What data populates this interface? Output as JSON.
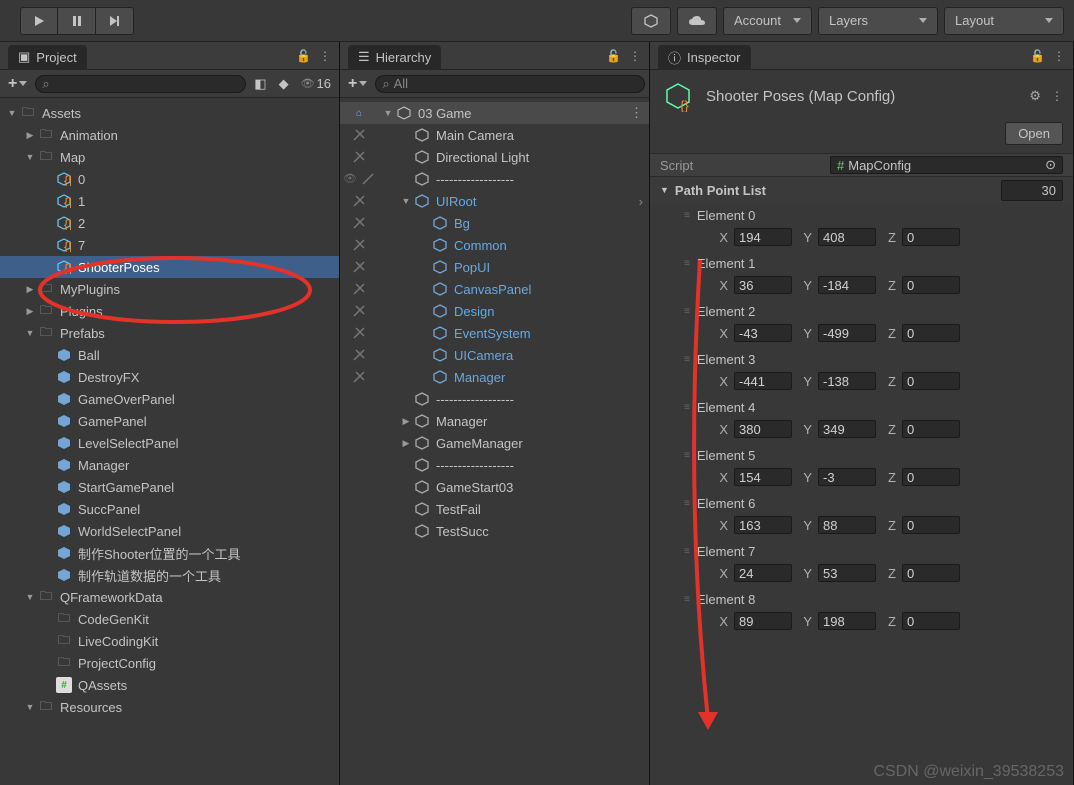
{
  "toolbar": {
    "account": "Account",
    "layers": "Layers",
    "layout": "Layout"
  },
  "project": {
    "title": "Project",
    "hidden_count": "16",
    "search_placeholder": "",
    "tree": [
      {
        "label": "Assets",
        "type": "folder",
        "depth": 0,
        "arrow": "open"
      },
      {
        "label": "Animation",
        "type": "folder",
        "depth": 1,
        "arrow": "closed"
      },
      {
        "label": "Map",
        "type": "folder",
        "depth": 1,
        "arrow": "open"
      },
      {
        "label": "0",
        "type": "asset-variant",
        "depth": 2,
        "arrow": "none"
      },
      {
        "label": "1",
        "type": "asset-variant",
        "depth": 2,
        "arrow": "none"
      },
      {
        "label": "2",
        "type": "asset-variant",
        "depth": 2,
        "arrow": "none"
      },
      {
        "label": "7",
        "type": "asset-variant",
        "depth": 2,
        "arrow": "none"
      },
      {
        "label": "ShooterPoses",
        "type": "asset-variant",
        "depth": 2,
        "arrow": "none",
        "selected": true
      },
      {
        "label": "MyPlugins",
        "type": "folder",
        "depth": 1,
        "arrow": "closed"
      },
      {
        "label": "Plugins",
        "type": "folder",
        "depth": 1,
        "arrow": "closed"
      },
      {
        "label": "Prefabs",
        "type": "folder",
        "depth": 1,
        "arrow": "open"
      },
      {
        "label": "Ball",
        "type": "prefab",
        "depth": 2,
        "arrow": "none"
      },
      {
        "label": "DestroyFX",
        "type": "prefab",
        "depth": 2,
        "arrow": "none"
      },
      {
        "label": "GameOverPanel",
        "type": "prefab",
        "depth": 2,
        "arrow": "none"
      },
      {
        "label": "GamePanel",
        "type": "prefab",
        "depth": 2,
        "arrow": "none"
      },
      {
        "label": "LevelSelectPanel",
        "type": "prefab",
        "depth": 2,
        "arrow": "none"
      },
      {
        "label": "Manager",
        "type": "prefab",
        "depth": 2,
        "arrow": "none"
      },
      {
        "label": "StartGamePanel",
        "type": "prefab",
        "depth": 2,
        "arrow": "none"
      },
      {
        "label": "SuccPanel",
        "type": "prefab",
        "depth": 2,
        "arrow": "none"
      },
      {
        "label": "WorldSelectPanel",
        "type": "prefab",
        "depth": 2,
        "arrow": "none"
      },
      {
        "label": "制作Shooter位置的一个工具",
        "type": "prefab",
        "depth": 2,
        "arrow": "none"
      },
      {
        "label": "制作轨道数据的一个工具",
        "type": "prefab",
        "depth": 2,
        "arrow": "none"
      },
      {
        "label": "QFrameworkData",
        "type": "folder",
        "depth": 1,
        "arrow": "open"
      },
      {
        "label": "CodeGenKit",
        "type": "folder",
        "depth": 2,
        "arrow": "none"
      },
      {
        "label": "LiveCodingKit",
        "type": "folder",
        "depth": 2,
        "arrow": "none"
      },
      {
        "label": "ProjectConfig",
        "type": "folder",
        "depth": 2,
        "arrow": "none"
      },
      {
        "label": "QAssets",
        "type": "script",
        "depth": 2,
        "arrow": "none"
      },
      {
        "label": "Resources",
        "type": "folder",
        "depth": 1,
        "arrow": "open"
      }
    ]
  },
  "hierarchy": {
    "title": "Hierarchy",
    "search_placeholder": "All",
    "tree": [
      {
        "label": "03 Game",
        "type": "scene",
        "depth": 0,
        "arrow": "open",
        "gutter": "home",
        "blue": false
      },
      {
        "label": "Main Camera",
        "type": "go",
        "depth": 1,
        "arrow": "none",
        "gutter": "strike",
        "blue": false
      },
      {
        "label": "Directional Light",
        "type": "go",
        "depth": 1,
        "arrow": "none",
        "gutter": "strike",
        "blue": false
      },
      {
        "label": "------------------",
        "type": "go",
        "depth": 1,
        "arrow": "none",
        "gutter": "eye",
        "blue": false
      },
      {
        "label": "UIRoot",
        "type": "go",
        "depth": 1,
        "arrow": "open",
        "gutter": "strike",
        "blue": true,
        "chev": true
      },
      {
        "label": "Bg",
        "type": "go",
        "depth": 2,
        "arrow": "none",
        "gutter": "strike",
        "blue": true
      },
      {
        "label": "Common",
        "type": "go",
        "depth": 2,
        "arrow": "none",
        "gutter": "strike",
        "blue": true
      },
      {
        "label": "PopUI",
        "type": "go",
        "depth": 2,
        "arrow": "none",
        "gutter": "strike",
        "blue": true
      },
      {
        "label": "CanvasPanel",
        "type": "go",
        "depth": 2,
        "arrow": "none",
        "gutter": "strike",
        "blue": true
      },
      {
        "label": "Design",
        "type": "go",
        "depth": 2,
        "arrow": "none",
        "gutter": "strike",
        "blue": true
      },
      {
        "label": "EventSystem",
        "type": "go",
        "depth": 2,
        "arrow": "none",
        "gutter": "strike",
        "blue": true
      },
      {
        "label": "UICamera",
        "type": "go",
        "depth": 2,
        "arrow": "none",
        "gutter": "strike",
        "blue": true
      },
      {
        "label": "Manager",
        "type": "go",
        "depth": 2,
        "arrow": "none",
        "gutter": "strike",
        "blue": true
      },
      {
        "label": "------------------",
        "type": "go",
        "depth": 1,
        "arrow": "none",
        "gutter": "",
        "blue": false
      },
      {
        "label": "Manager",
        "type": "go",
        "depth": 1,
        "arrow": "closed",
        "gutter": "",
        "blue": false
      },
      {
        "label": "GameManager",
        "type": "go",
        "depth": 1,
        "arrow": "closed",
        "gutter": "",
        "blue": false
      },
      {
        "label": "------------------",
        "type": "go",
        "depth": 1,
        "arrow": "none",
        "gutter": "",
        "blue": false
      },
      {
        "label": "GameStart03",
        "type": "go",
        "depth": 1,
        "arrow": "none",
        "gutter": "",
        "blue": false
      },
      {
        "label": "TestFail",
        "type": "go",
        "depth": 1,
        "arrow": "none",
        "gutter": "",
        "blue": false
      },
      {
        "label": "TestSucc",
        "type": "go",
        "depth": 1,
        "arrow": "none",
        "gutter": "",
        "blue": false
      }
    ]
  },
  "inspector": {
    "title": "Inspector",
    "asset_name": "Shooter Poses (Map Config)",
    "open_label": "Open",
    "script_label": "Script",
    "script_value": "MapConfig",
    "list_label": "Path Point List",
    "list_count": "30",
    "elements": [
      {
        "name": "Element 0",
        "x": "194",
        "y": "408",
        "z": "0"
      },
      {
        "name": "Element 1",
        "x": "36",
        "y": "-184",
        "z": "0"
      },
      {
        "name": "Element 2",
        "x": "-43",
        "y": "-499",
        "z": "0"
      },
      {
        "name": "Element 3",
        "x": "-441",
        "y": "-138",
        "z": "0"
      },
      {
        "name": "Element 4",
        "x": "380",
        "y": "349",
        "z": "0"
      },
      {
        "name": "Element 5",
        "x": "154",
        "y": "-3",
        "z": "0"
      },
      {
        "name": "Element 6",
        "x": "163",
        "y": "88",
        "z": "0"
      },
      {
        "name": "Element 7",
        "x": "24",
        "y": "53",
        "z": "0"
      },
      {
        "name": "Element 8",
        "x": "89",
        "y": "198",
        "z": "0"
      }
    ]
  },
  "watermark": "CSDN @weixin_39538253"
}
